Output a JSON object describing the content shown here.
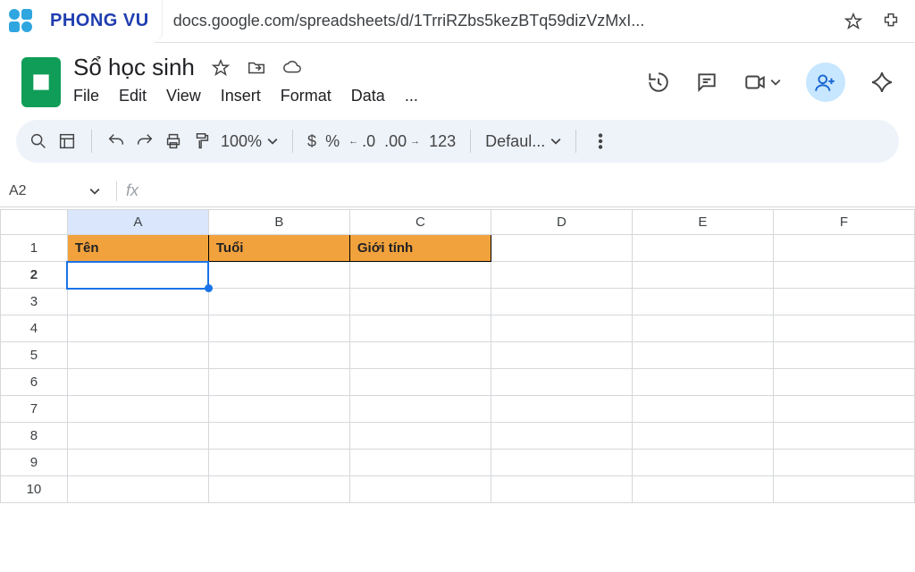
{
  "browser": {
    "brand": "PHONG VU",
    "url": "docs.google.com/spreadsheets/d/1TrriRZbs5kezBTq59dizVzMxI..."
  },
  "doc": {
    "title": "Sổ học sinh"
  },
  "menus": {
    "file": "File",
    "edit": "Edit",
    "view": "View",
    "insert": "Insert",
    "format": "Format",
    "data": "Data",
    "more": "..."
  },
  "toolbar": {
    "zoom": "100%",
    "currency": "$",
    "percent": "%",
    "dec_dec": ".0",
    "dec_inc": ".00",
    "numfmt": "123",
    "font": "Defaul..."
  },
  "namebox": {
    "ref": "A2"
  },
  "fx": {
    "sym": "fx"
  },
  "grid": {
    "cols": [
      "A",
      "B",
      "C",
      "D",
      "E",
      "F"
    ],
    "selected_col": "A",
    "rows": [
      "1",
      "2",
      "3",
      "4",
      "5",
      "6",
      "7",
      "8",
      "9",
      "10"
    ],
    "selected_row": "2",
    "headers": {
      "A": "Tên",
      "B": "Tuổi",
      "C": "Giới tính"
    }
  }
}
